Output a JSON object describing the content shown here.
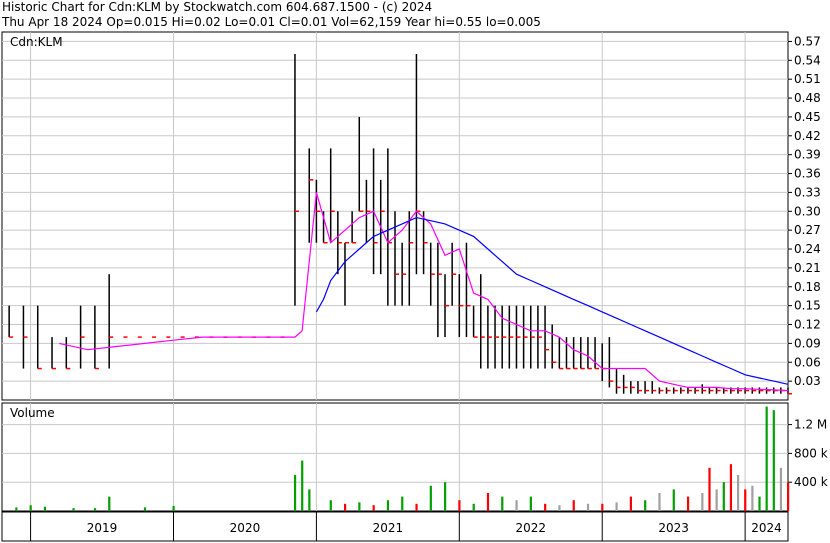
{
  "header": {
    "line1": "Historic Chart for Cdn:KLM by Stockwatch.com 604.687.1500 - (c) 2024",
    "line2": "Thu Apr 18 2024  Op=0.015  Hi=0.02  Lo=0.01  Cl=0.01  Vol=62,159  Year hi=0.55  lo=0.005"
  },
  "price_panel": {
    "symbol_label": "Cdn:KLM"
  },
  "volume_panel": {
    "label": "Volume"
  },
  "colors": {
    "price_bar": "#000000",
    "close_tick": "#ff0000",
    "ma_short": "#ff00ff",
    "ma_long": "#0000ff",
    "vol_up": "#00a000",
    "vol_down": "#ff0000",
    "vol_neutral": "#a0a0a0",
    "grid": "#c8c8c8"
  },
  "chart_data": [
    {
      "type": "line",
      "title": "Cdn:KLM",
      "ylim": [
        0,
        0.585
      ],
      "y_ticks": [
        "0.57",
        "0.54",
        "0.51",
        "0.48",
        "0.45",
        "0.42",
        "0.39",
        "0.36",
        "0.33",
        "0.30",
        "0.27",
        "0.24",
        "0.21",
        "0.18",
        "0.15",
        "0.12",
        "0.09",
        "0.06",
        "0.03"
      ],
      "x_labels": [
        "2019",
        "2020",
        "2021",
        "2022",
        "2023",
        "2024"
      ],
      "grid": true,
      "series": [
        {
          "type": "hlc-bars",
          "x": [
            2018.85,
            2018.95,
            2019.05,
            2019.15,
            2019.25,
            2019.35,
            2019.45,
            2019.55,
            2019.65,
            2019.75,
            2019.85,
            2019.95,
            2020.05,
            2020.15,
            2020.25,
            2020.35,
            2020.45,
            2020.55,
            2020.65,
            2020.75,
            2020.85,
            2020.95,
            2021.0,
            2021.05,
            2021.1,
            2021.15,
            2021.2,
            2021.25,
            2021.3,
            2021.35,
            2021.4,
            2021.45,
            2021.5,
            2021.55,
            2021.6,
            2021.65,
            2021.7,
            2021.75,
            2021.8,
            2021.85,
            2021.9,
            2021.95,
            2022.0,
            2022.05,
            2022.1,
            2022.15,
            2022.2,
            2022.25,
            2022.3,
            2022.35,
            2022.4,
            2022.45,
            2022.5,
            2022.55,
            2022.6,
            2022.65,
            2022.7,
            2022.75,
            2022.8,
            2022.85,
            2022.9,
            2022.95,
            2023.0,
            2023.05,
            2023.1,
            2023.15,
            2023.2,
            2023.25,
            2023.3,
            2023.35,
            2023.4,
            2023.45,
            2023.5,
            2023.55,
            2023.6,
            2023.65,
            2023.7,
            2023.75,
            2023.8,
            2023.85,
            2023.9,
            2023.95,
            2024.0,
            2024.05,
            2024.1,
            2024.15,
            2024.2,
            2024.25,
            2024.3
          ],
          "high": [
            0.15,
            0.15,
            0.15,
            0.1,
            0.1,
            0.15,
            0.15,
            0.2,
            0.1,
            0.1,
            0.1,
            0.1,
            0.1,
            0.1,
            0.1,
            0.1,
            0.1,
            0.1,
            0.1,
            0.1,
            0.55,
            0.4,
            0.35,
            0.3,
            0.4,
            0.3,
            0.25,
            0.3,
            0.45,
            0.35,
            0.4,
            0.35,
            0.4,
            0.3,
            0.25,
            0.3,
            0.55,
            0.3,
            0.25,
            0.25,
            0.2,
            0.25,
            0.2,
            0.25,
            0.15,
            0.2,
            0.15,
            0.15,
            0.15,
            0.15,
            0.15,
            0.15,
            0.15,
            0.15,
            0.15,
            0.12,
            0.1,
            0.1,
            0.1,
            0.1,
            0.1,
            0.1,
            0.09,
            0.1,
            0.05,
            0.04,
            0.03,
            0.03,
            0.03,
            0.03,
            0.02,
            0.02,
            0.02,
            0.02,
            0.02,
            0.02,
            0.025,
            0.02,
            0.02,
            0.02,
            0.02,
            0.02,
            0.02,
            0.02,
            0.02,
            0.02,
            0.02,
            0.02,
            0.02
          ],
          "low": [
            0.1,
            0.05,
            0.05,
            0.05,
            0.05,
            0.05,
            0.05,
            0.05,
            0.1,
            0.1,
            0.1,
            0.1,
            0.1,
            0.1,
            0.1,
            0.1,
            0.1,
            0.1,
            0.1,
            0.1,
            0.15,
            0.25,
            0.25,
            0.25,
            0.25,
            0.2,
            0.15,
            0.25,
            0.3,
            0.25,
            0.2,
            0.2,
            0.15,
            0.15,
            0.15,
            0.15,
            0.2,
            0.2,
            0.15,
            0.1,
            0.1,
            0.15,
            0.1,
            0.1,
            0.1,
            0.05,
            0.05,
            0.05,
            0.05,
            0.05,
            0.05,
            0.05,
            0.05,
            0.05,
            0.05,
            0.05,
            0.05,
            0.05,
            0.05,
            0.05,
            0.05,
            0.05,
            0.03,
            0.02,
            0.01,
            0.01,
            0.01,
            0.01,
            0.01,
            0.01,
            0.01,
            0.01,
            0.01,
            0.01,
            0.01,
            0.01,
            0.01,
            0.01,
            0.01,
            0.01,
            0.01,
            0.01,
            0.01,
            0.01,
            0.01,
            0.01,
            0.01,
            0.01,
            0.01
          ],
          "close": [
            0.1,
            0.1,
            0.05,
            0.05,
            0.05,
            0.1,
            0.05,
            0.1,
            0.1,
            0.1,
            0.1,
            0.1,
            0.1,
            0.1,
            0.1,
            0.1,
            0.1,
            0.1,
            0.1,
            0.1,
            0.3,
            0.35,
            0.3,
            0.25,
            0.3,
            0.25,
            0.25,
            0.25,
            0.3,
            0.3,
            0.25,
            0.3,
            0.25,
            0.2,
            0.2,
            0.25,
            0.3,
            0.25,
            0.2,
            0.2,
            0.15,
            0.2,
            0.15,
            0.15,
            0.1,
            0.1,
            0.1,
            0.1,
            0.1,
            0.1,
            0.1,
            0.1,
            0.1,
            0.1,
            0.08,
            0.06,
            0.05,
            0.05,
            0.05,
            0.05,
            0.05,
            0.05,
            0.05,
            0.03,
            0.02,
            0.02,
            0.02,
            0.015,
            0.015,
            0.015,
            0.015,
            0.015,
            0.015,
            0.015,
            0.015,
            0.015,
            0.015,
            0.015,
            0.015,
            0.015,
            0.015,
            0.015,
            0.015,
            0.015,
            0.015,
            0.015,
            0.015,
            0.015,
            0.01
          ]
        },
        {
          "name": "",
          "type": "moving-average-short",
          "x": [
            2019.2,
            2019.4,
            2019.6,
            2019.8,
            2020.0,
            2020.2,
            2020.4,
            2020.6,
            2020.85,
            2020.9,
            2021.0,
            2021.1,
            2021.2,
            2021.3,
            2021.4,
            2021.5,
            2021.6,
            2021.7,
            2021.8,
            2021.9,
            2022.0,
            2022.1,
            2022.2,
            2022.3,
            2022.4,
            2022.5,
            2022.6,
            2022.7,
            2022.8,
            2022.9,
            2023.0,
            2023.1,
            2023.2,
            2023.3,
            2023.4,
            2023.5,
            2023.6,
            2023.7,
            2023.8,
            2023.9,
            2024.0,
            2024.1,
            2024.2,
            2024.3
          ],
          "values": [
            0.09,
            0.08,
            0.085,
            0.09,
            0.095,
            0.1,
            0.1,
            0.1,
            0.1,
            0.11,
            0.33,
            0.25,
            0.27,
            0.29,
            0.3,
            0.25,
            0.27,
            0.3,
            0.28,
            0.23,
            0.24,
            0.17,
            0.16,
            0.13,
            0.12,
            0.11,
            0.11,
            0.1,
            0.08,
            0.07,
            0.05,
            0.05,
            0.05,
            0.05,
            0.03,
            0.025,
            0.02,
            0.02,
            0.02,
            0.018,
            0.018,
            0.017,
            0.016,
            0.015
          ]
        },
        {
          "name": "",
          "type": "moving-average-long",
          "x": [
            2021.0,
            2021.05,
            2021.1,
            2021.2,
            2021.3,
            2021.4,
            2021.5,
            2021.6,
            2021.7,
            2021.8,
            2021.9,
            2022.0,
            2022.1,
            2022.2,
            2022.3,
            2022.4,
            2022.5,
            2022.6,
            2022.7,
            2022.8,
            2022.9,
            2023.0,
            2023.1,
            2023.2,
            2023.3,
            2023.4,
            2023.5,
            2023.6,
            2023.7,
            2023.8,
            2023.9,
            2024.0,
            2024.1,
            2024.2,
            2024.3
          ],
          "values": [
            0.14,
            0.16,
            0.19,
            0.22,
            0.24,
            0.26,
            0.27,
            0.28,
            0.29,
            0.285,
            0.28,
            0.27,
            0.26,
            0.24,
            0.22,
            0.2,
            0.19,
            0.18,
            0.17,
            0.16,
            0.15,
            0.14,
            0.13,
            0.12,
            0.11,
            0.1,
            0.09,
            0.08,
            0.07,
            0.06,
            0.05,
            0.04,
            0.035,
            0.03,
            0.025
          ]
        }
      ]
    },
    {
      "type": "bar",
      "title": "Volume",
      "ylim": [
        0,
        1500000
      ],
      "y_ticks": [
        "1.2 M",
        "800 k",
        "400 k"
      ],
      "x": [
        2018.9,
        2019.0,
        2019.1,
        2019.3,
        2019.45,
        2019.55,
        2019.8,
        2020.0,
        2020.85,
        2020.9,
        2020.95,
        2021.1,
        2021.2,
        2021.3,
        2021.4,
        2021.5,
        2021.6,
        2021.7,
        2021.8,
        2021.9,
        2022.0,
        2022.1,
        2022.2,
        2022.3,
        2022.4,
        2022.5,
        2022.6,
        2022.7,
        2022.8,
        2022.9,
        2023.0,
        2023.1,
        2023.2,
        2023.3,
        2023.4,
        2023.5,
        2023.6,
        2023.7,
        2023.75,
        2023.8,
        2023.85,
        2023.9,
        2023.95,
        2024.0,
        2024.05,
        2024.1,
        2024.15,
        2024.2,
        2024.25,
        2024.3
      ],
      "values": [
        50000,
        80000,
        60000,
        40000,
        40000,
        200000,
        50000,
        70000,
        500000,
        700000,
        300000,
        150000,
        100000,
        120000,
        80000,
        150000,
        200000,
        100000,
        350000,
        400000,
        150000,
        100000,
        250000,
        200000,
        150000,
        200000,
        100000,
        80000,
        150000,
        100000,
        100000,
        120000,
        200000,
        150000,
        250000,
        300000,
        200000,
        250000,
        600000,
        300000,
        400000,
        650000,
        500000,
        300000,
        350000,
        200000,
        1450000,
        1400000,
        600000,
        400000
      ],
      "direction": [
        "up",
        "up",
        "up",
        "up",
        "up",
        "up",
        "up",
        "up",
        "up",
        "up",
        "up",
        "up",
        "down",
        "up",
        "down",
        "up",
        "up",
        "down",
        "up",
        "up",
        "down",
        "up",
        "down",
        "up",
        "neutral",
        "up",
        "down",
        "neutral",
        "down",
        "neutral",
        "down",
        "neutral",
        "down",
        "up",
        "neutral",
        "up",
        "down",
        "neutral",
        "down",
        "neutral",
        "up",
        "down",
        "neutral",
        "down",
        "neutral",
        "up",
        "up",
        "up",
        "neutral",
        "down"
      ]
    }
  ]
}
